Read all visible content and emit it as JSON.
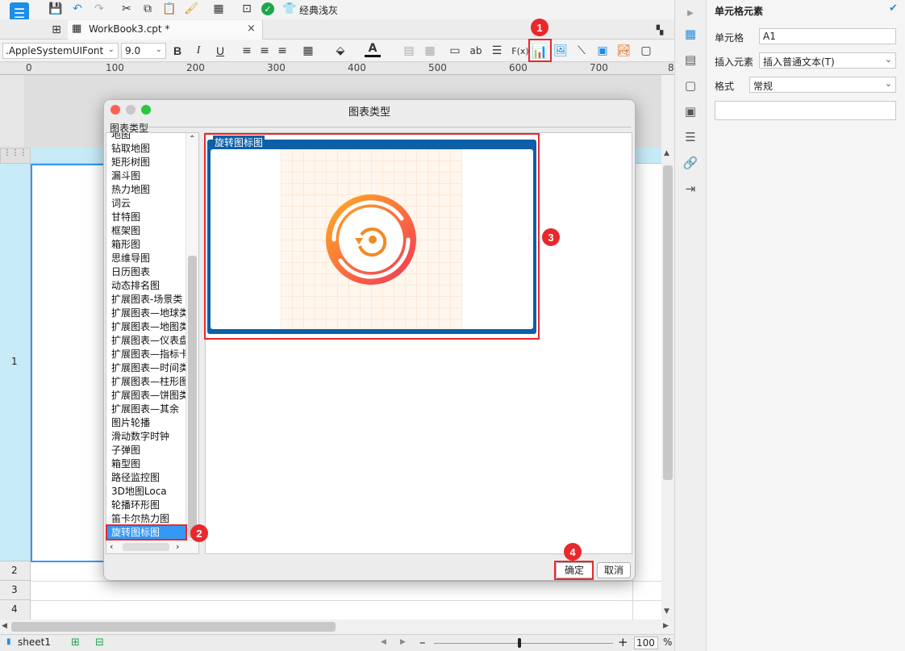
{
  "toolbar": {
    "theme_label": "经典浅灰"
  },
  "tabs": [
    {
      "label": "WorkBook3.cpt *"
    }
  ],
  "format": {
    "font_name": ".AppleSystemUIFont",
    "font_size": "9.0",
    "bold": "B",
    "italic": "I",
    "underline": "U",
    "text_ab": "ab",
    "fx": "F(x)"
  },
  "ruler": {
    "ticks": [
      "0",
      "100",
      "200",
      "300",
      "400",
      "500",
      "600",
      "700",
      "8"
    ]
  },
  "rows": [
    "1",
    "2",
    "3",
    "4"
  ],
  "dialog": {
    "title": "图表类型",
    "group_label": "图表类型",
    "items": [
      "地图",
      "钻取地图",
      "矩形树图",
      "漏斗图",
      "热力地图",
      "词云",
      "甘特图",
      "框架图",
      "箱形图",
      "思维导图",
      "日历图表",
      "动态排名图",
      "扩展图表-场景类",
      "扩展图表—地球类",
      "扩展图表—地图类",
      "扩展图表—仪表盘",
      "扩展图表—指标卡",
      "扩展图表—时间类",
      "扩展图表—柱形图",
      "扩展图表—饼图类",
      "扩展图表—其余",
      "图片轮播",
      "滑动数字时钟",
      "子弹图",
      "箱型图",
      "路径监控图",
      "3D地图Loca",
      "轮播环形图",
      "笛卡尔热力图",
      "旋转图标图"
    ],
    "selected": "旋转图标图",
    "preview_title": "旋转图标图",
    "ok": "确定",
    "cancel": "取消"
  },
  "badges": [
    "1",
    "2",
    "3",
    "4"
  ],
  "right_panel": {
    "title": "单元格元素",
    "cell_label": "单元格",
    "cell_value": "A1",
    "insert_label": "插入元素",
    "insert_value": "插入普通文本(T)",
    "format_label": "格式",
    "format_value": "常规"
  },
  "bottom": {
    "sheet": "sheet1",
    "zoom": "100",
    "percent": "%"
  },
  "colors": {
    "accent": "#1c8ee8",
    "dialog_blue": "#0d5fa8",
    "badge_red": "#e8282b",
    "selection_blue": "#3598f5"
  }
}
